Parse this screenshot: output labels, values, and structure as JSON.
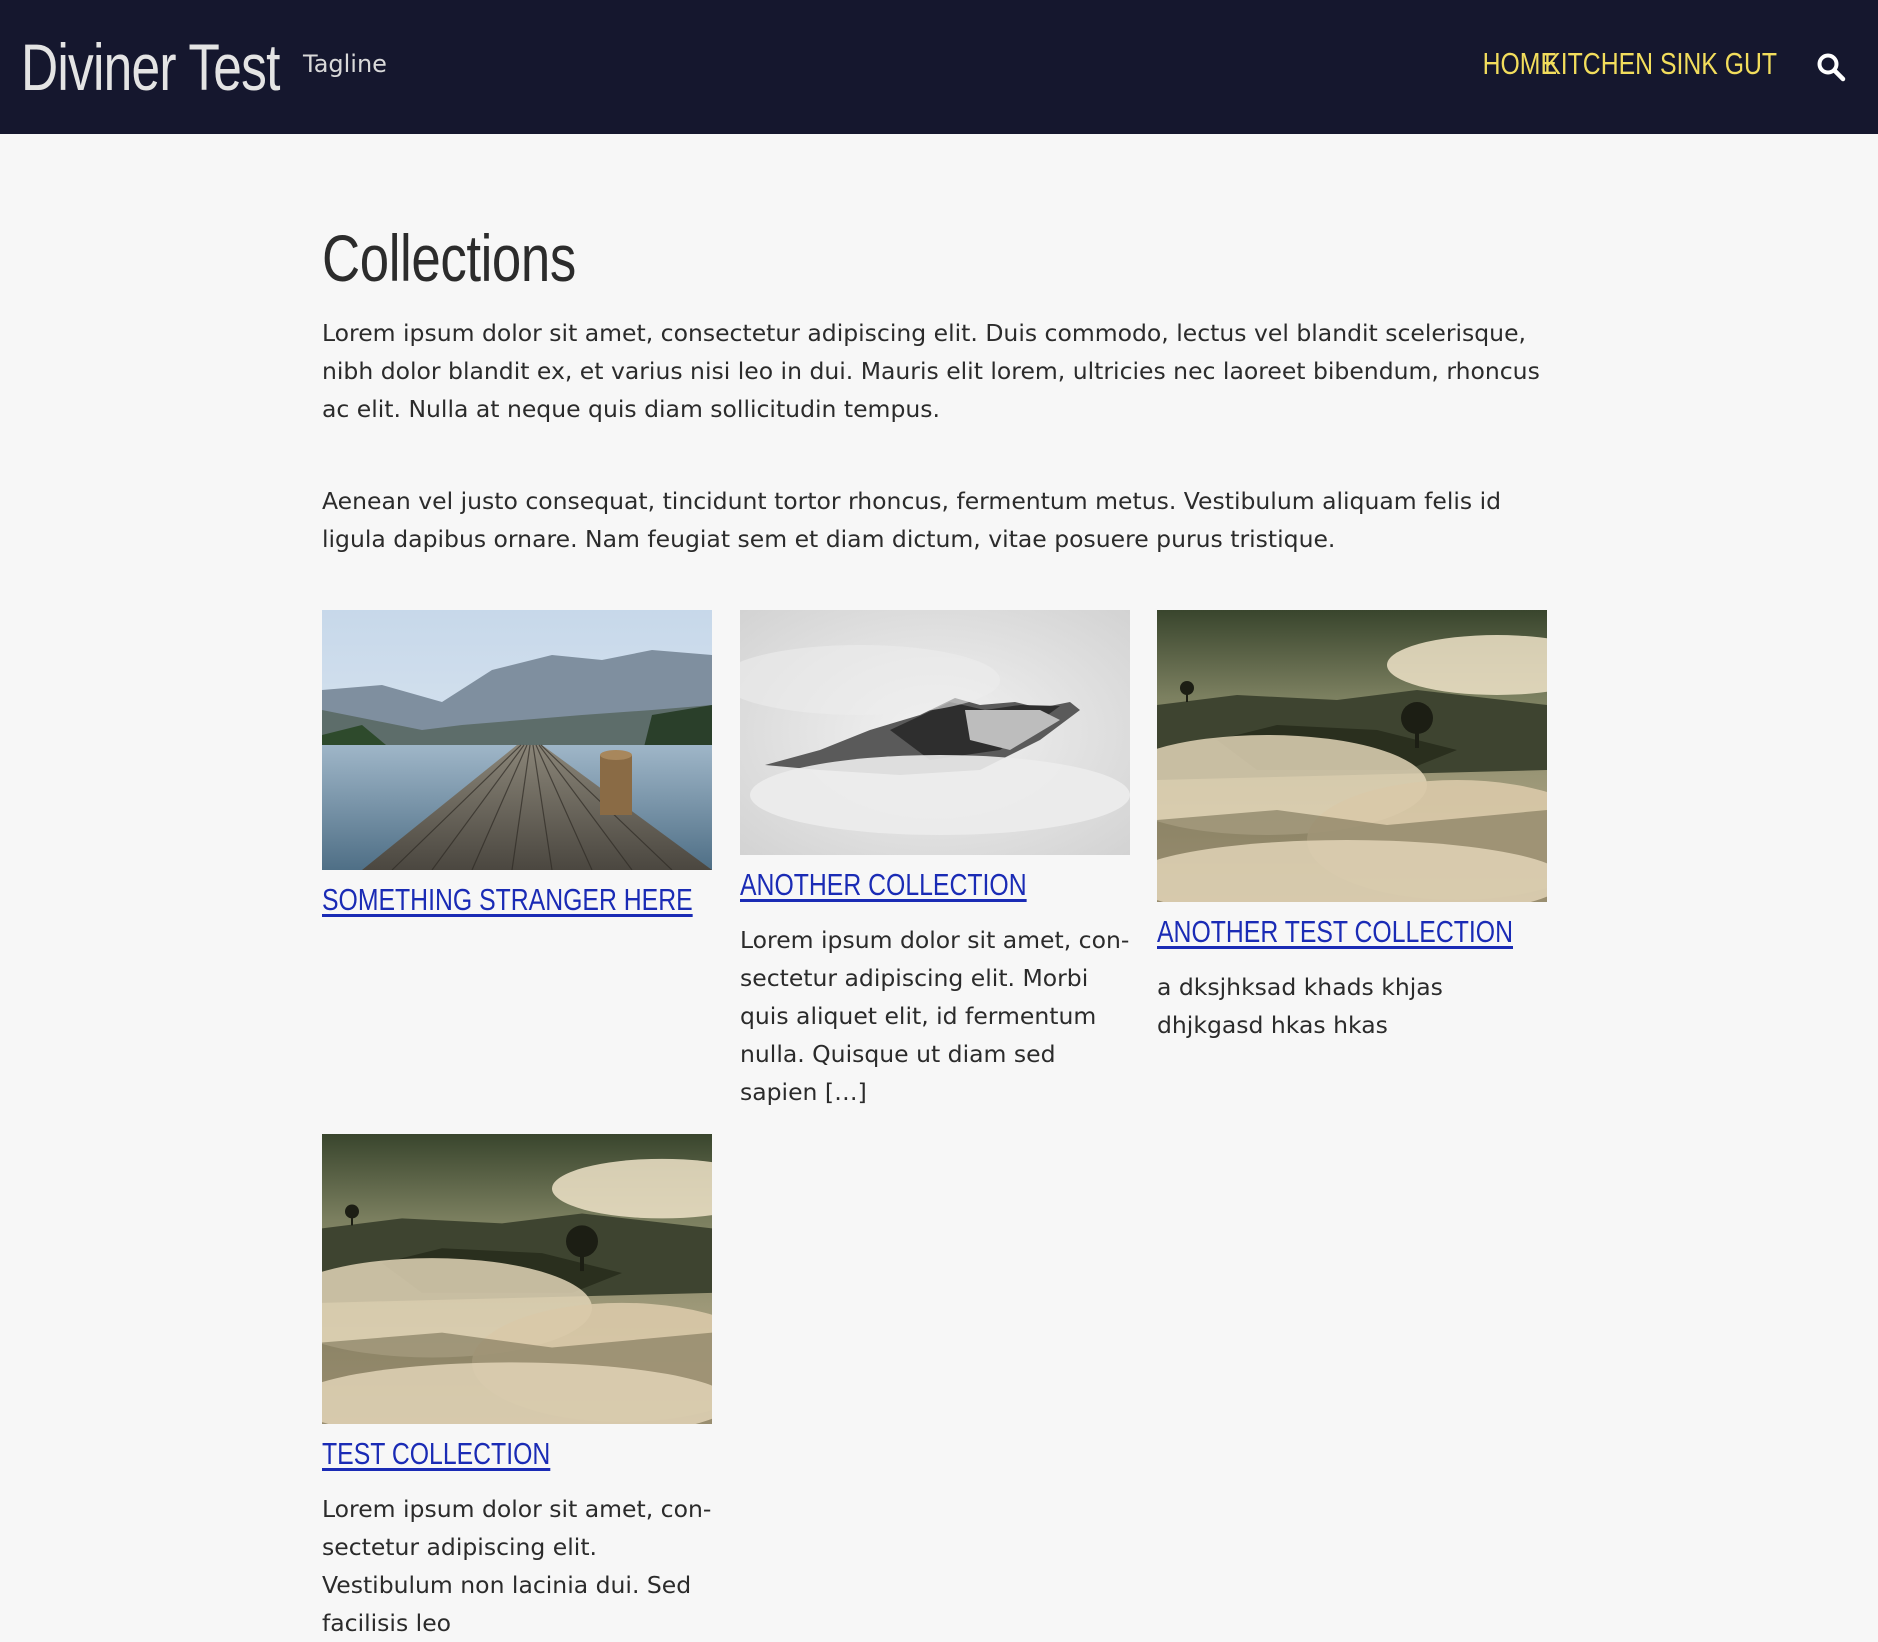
{
  "header": {
    "site_title": "Diviner Test",
    "tagline": "Tagline",
    "nav": [
      {
        "label": "HOME"
      },
      {
        "label": "KITCHEN SINK GUT"
      }
    ],
    "search_icon": "search-icon",
    "colors": {
      "background": "#15172e",
      "nav_link": "#f2dd5c",
      "title": "#e4e4e4"
    }
  },
  "main": {
    "title": "Collections",
    "paragraphs": [
      "Lorem ipsum dolor sit amet, consectetur adipiscing elit. Duis commodo, lectus vel blandit scelerisque, nibh dolor blandit ex, et varius nisi leo in dui. Mauris elit lorem, ultricies nec laoreet bibendum, rhoncus ac elit. Nulla at neque quis diam sollicitudin tempus.",
      "Aenean vel justo consequat, tincidunt tortor rhoncus, fermentum metus. Vestibulum aliquam felis id ligula dapibus ornare. Nam feugiat sem et diam dictum, vitae posuere purus tristique."
    ],
    "collections": [
      {
        "title": "SOMETHING STRANGER HERE",
        "description": "",
        "image": "lake-dock-photo"
      },
      {
        "title": "ANOTHER COLLECTION",
        "description": "Lorem ipsum dolor sit amet, con­sectetur adipiscing elit. Morbi quis aliquet elit, id fermentum nulla. Quisque ut diam sed sapien […]",
        "image": "misty-mountain-photo"
      },
      {
        "title": "ANOTHER TEST COLLECTION",
        "description": "a dksjhksad khads khjas dhjkgasd hkas hkas",
        "image": "foggy-hills-photo"
      },
      {
        "title": "TEST COLLECTION",
        "description": "Lorem ipsum dolor sit amet, con­sectetur adipiscing elit. Vestibulum non lacinia dui. Sed facilisis leo",
        "image": "foggy-hills-photo"
      }
    ],
    "colors": {
      "link": "#1a2bb5",
      "page_background": "#f7f7f7"
    }
  }
}
